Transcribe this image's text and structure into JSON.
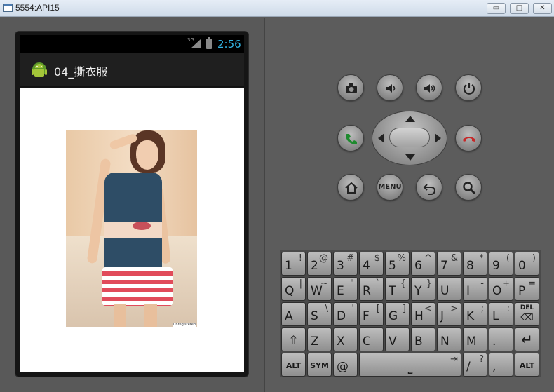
{
  "window": {
    "title": "5554:API15",
    "min_glyph": "▭",
    "max_glyph": "□",
    "close_glyph": "✕"
  },
  "status": {
    "network": "3G",
    "time": "2:56"
  },
  "app": {
    "title": "04_撕衣服",
    "watermark": "Unregistered"
  },
  "controls": {
    "menu_label": "MENU"
  },
  "keyboard": {
    "rows": [
      [
        {
          "m": "1",
          "s": "!"
        },
        {
          "m": "2",
          "s": "@"
        },
        {
          "m": "3",
          "s": "#"
        },
        {
          "m": "4",
          "s": "$"
        },
        {
          "m": "5",
          "s": "%"
        },
        {
          "m": "6",
          "s": "^"
        },
        {
          "m": "7",
          "s": "&"
        },
        {
          "m": "8",
          "s": "*"
        },
        {
          "m": "9",
          "s": "("
        },
        {
          "m": "0",
          "s": ")"
        }
      ],
      [
        {
          "m": "Q",
          "s": "|"
        },
        {
          "m": "W",
          "s": "~"
        },
        {
          "m": "E",
          "s": "\""
        },
        {
          "m": "R",
          "s": "`"
        },
        {
          "m": "T",
          "s": "{"
        },
        {
          "m": "Y",
          "s": "}"
        },
        {
          "m": "U",
          "s": "_"
        },
        {
          "m": "I",
          "s": "-"
        },
        {
          "m": "O",
          "s": "+"
        },
        {
          "m": "P",
          "s": "="
        }
      ],
      [
        {
          "m": "A",
          "s": ""
        },
        {
          "m": "S",
          "s": "\\"
        },
        {
          "m": "D",
          "s": "'"
        },
        {
          "m": "F",
          "s": "["
        },
        {
          "m": "G",
          "s": "]"
        },
        {
          "m": "H",
          "s": "<"
        },
        {
          "m": "J",
          "s": ">"
        },
        {
          "m": "K",
          "s": ";"
        },
        {
          "m": "L",
          "s": ":"
        },
        {
          "m": "",
          "s": ""
        }
      ],
      [
        {
          "m": "",
          "s": ""
        },
        {
          "m": "Z",
          "s": ""
        },
        {
          "m": "X",
          "s": ""
        },
        {
          "m": "C",
          "s": ""
        },
        {
          "m": "V",
          "s": ""
        },
        {
          "m": "B",
          "s": ""
        },
        {
          "m": "N",
          "s": ""
        },
        {
          "m": "M",
          "s": ""
        },
        {
          "m": ".",
          "s": ""
        },
        {
          "m": "",
          "s": ""
        }
      ]
    ],
    "del_label": "DEL",
    "alt_label": "ALT",
    "sym_label": "SYM",
    "at_label": "@",
    "slash_main": "/",
    "slash_shift": "?",
    "comma_label": ","
  }
}
